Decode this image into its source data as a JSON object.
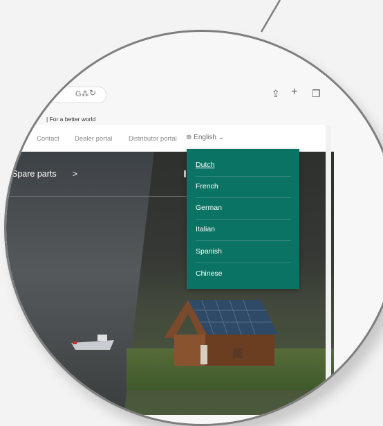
{
  "browser": {
    "tab_title": "| For a better world",
    "translate_icon": "translate-icon",
    "reload_icon": "reload-icon",
    "share_icon": "share-icon",
    "new_tab_icon": "plus-icon",
    "tabs_icon": "tabs-icon"
  },
  "nav": {
    "links": [
      "Contact",
      "Dealer portal",
      "Distributor portal"
    ],
    "language_label": "English"
  },
  "hero": {
    "spare_parts_label": "Spare parts",
    "spare_parts_arrow": ">"
  },
  "language_menu": {
    "items": [
      "Dutch",
      "French",
      "German",
      "Italian",
      "Spanish",
      "Chinese"
    ],
    "selected": "Dutch"
  },
  "colors": {
    "accent": "#0b7364",
    "lens_border": "#7e7e7e"
  }
}
